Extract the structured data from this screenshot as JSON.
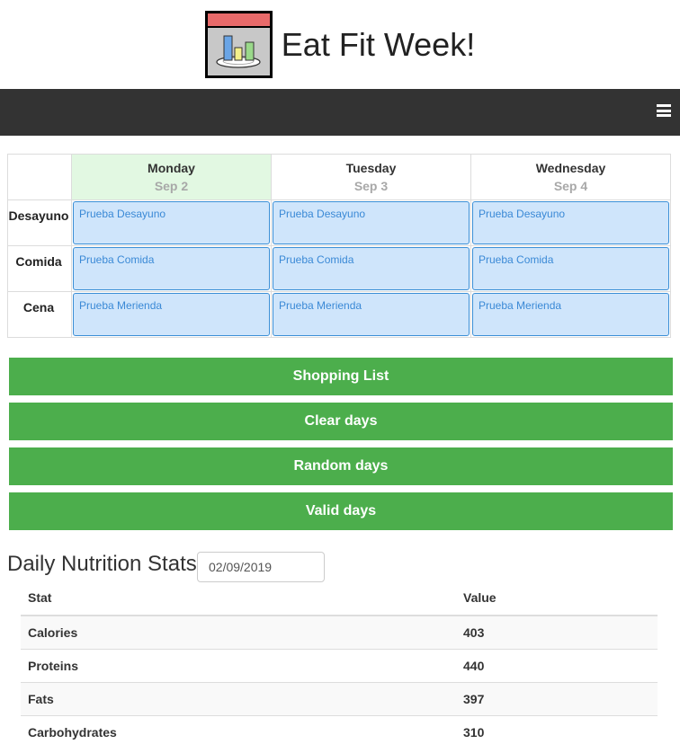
{
  "app": {
    "title": "Eat Fit Week!"
  },
  "navbar": {
    "menu_icon": "hamburger-menu-icon"
  },
  "planner": {
    "days": [
      {
        "name": "Monday",
        "date": "Sep 2",
        "today": true
      },
      {
        "name": "Tuesday",
        "date": "Sep 3",
        "today": false
      },
      {
        "name": "Wednesday",
        "date": "Sep 4",
        "today": false
      }
    ],
    "meals": [
      {
        "label": "Desayuno",
        "entries": [
          "Prueba Desayuno",
          "Prueba Desayuno",
          "Prueba Desayuno"
        ]
      },
      {
        "label": "Comida",
        "entries": [
          "Prueba Comida",
          "Prueba Comida",
          "Prueba Comida"
        ]
      },
      {
        "label": "Cena",
        "entries": [
          "Prueba Merienda",
          "Prueba Merienda",
          "Prueba Merienda"
        ]
      }
    ],
    "colors": {
      "today_bg": "#e2f8e2",
      "meal_bg": "#cfe5fb",
      "meal_border": "#3b8fd6"
    }
  },
  "actions": {
    "shopping_list": "Shopping List",
    "clear_days": "Clear days",
    "random_days": "Random days",
    "valid_days": "Valid days",
    "color": "#4cae4c"
  },
  "stats": {
    "title": "Daily Nutrition Stats",
    "date_value": "02/09/2019",
    "headers": {
      "stat": "Stat",
      "value": "Value"
    },
    "rows": [
      {
        "stat": "Calories",
        "value": "403"
      },
      {
        "stat": "Proteins",
        "value": "440"
      },
      {
        "stat": "Fats",
        "value": "397"
      },
      {
        "stat": "Carbohydrates",
        "value": "310"
      }
    ]
  }
}
